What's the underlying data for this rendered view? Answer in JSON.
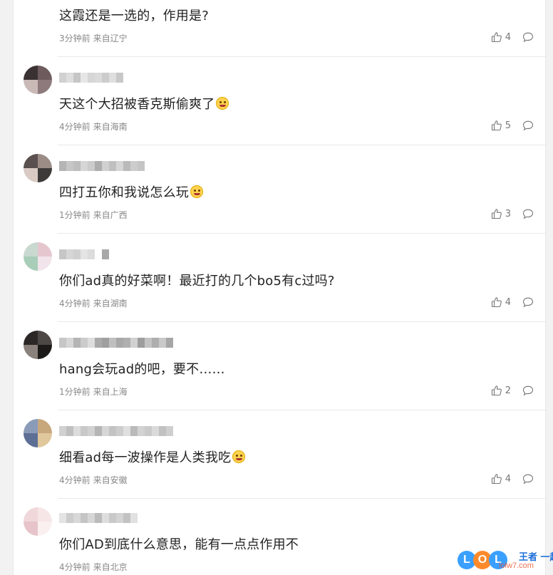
{
  "comments": [
    {
      "content": "这霞还是一选的，作用是?",
      "emoji": null,
      "time": "3分钟前",
      "location": "来自辽宁",
      "likes": "4",
      "avatar_colors": []
    },
    {
      "content": "天这个大招被香克斯偷爽了",
      "emoji": "grinning-face-emoji",
      "time": "4分钟前",
      "location": "来自海南",
      "likes": "5",
      "avatar_colors": [
        "#3a3133",
        "#6d5b5e",
        "#c9b9b7",
        "#8e7a7c"
      ]
    },
    {
      "content": "四打五你和我说怎么玩",
      "emoji": "grimacing-face-emoji",
      "time": "1分钟前",
      "location": "来自广西",
      "likes": "3",
      "avatar_colors": [
        "#5b5050",
        "#9c8c86",
        "#d9cbc4",
        "#3f3a3a"
      ]
    },
    {
      "content": "你们ad真的好菜啊！最近打的几个bo5有c过吗?",
      "emoji": null,
      "time": "4分钟前",
      "location": "来自湖南",
      "likes": "4",
      "avatar_colors": [
        "#c9d9d0",
        "#e5c6cf",
        "#a8cdb9",
        "#f1e4ea"
      ]
    },
    {
      "content": "hang会玩ad的吧，要不……",
      "emoji": null,
      "time": "1分钟前",
      "location": "来自上海",
      "likes": "2",
      "avatar_colors": [
        "#2a2726",
        "#4d4745",
        "#8a817c",
        "#1c1a19"
      ]
    },
    {
      "content": "细看ad每一波操作是人类我吃",
      "emoji": "open-mouth-face-emoji",
      "time": "4分钟前",
      "location": "来自安徽",
      "likes": "4",
      "avatar_colors": [
        "#8a9bb8",
        "#c7a77c",
        "#5d6f94",
        "#e0c89c"
      ]
    },
    {
      "content": "你们AD到底什么意思，能有一点点作用不",
      "emoji": null,
      "time": "4分钟前",
      "location": "来自北京",
      "likes": "",
      "avatar_colors": [
        "#efd7da",
        "#f6e6e6",
        "#e6c4c9",
        "#fbf0f0"
      ]
    }
  ],
  "watermark": {
    "letters": [
      "L",
      "O",
      "L"
    ],
    "title": "王者 一起上",
    "subtitle": "lolw7.com"
  },
  "colors": {
    "wm_blue": "#3aa0ff",
    "wm_orange": "#ff8a2a",
    "wm_pink": "#ff4f8a"
  }
}
